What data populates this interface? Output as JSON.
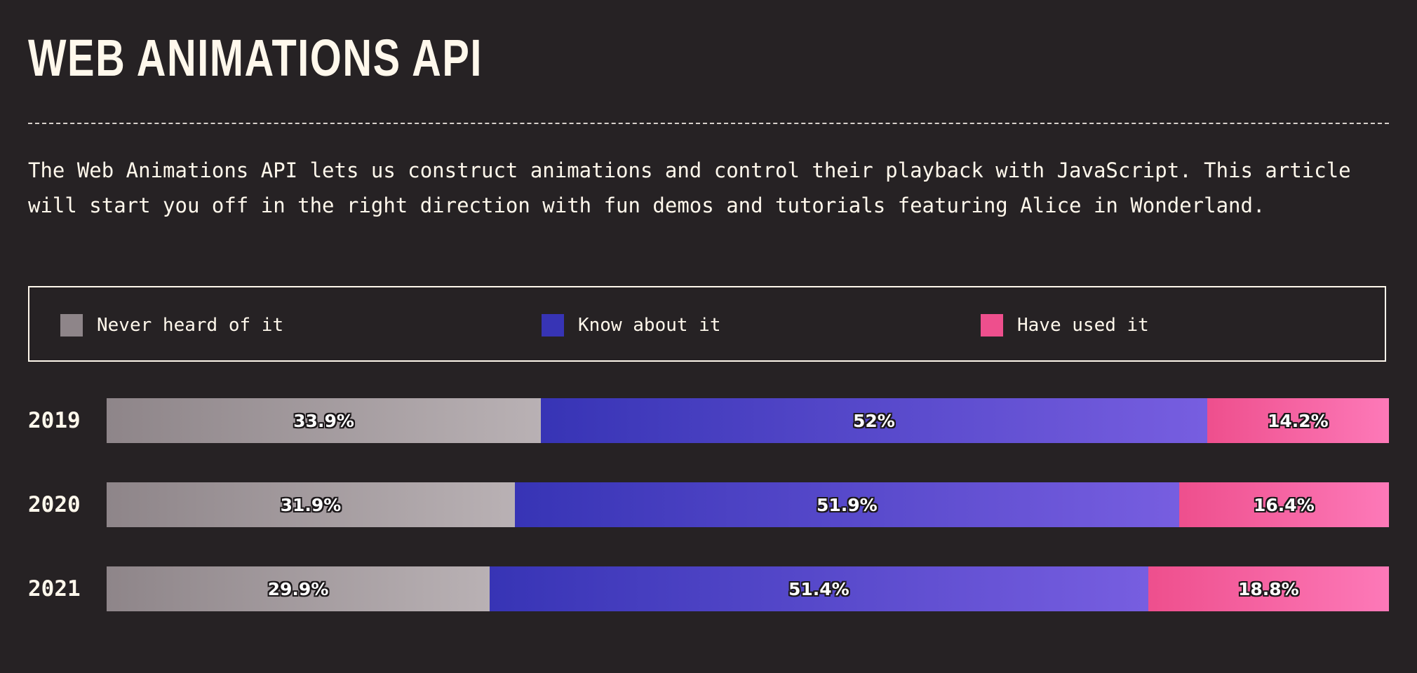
{
  "title": "WEB ANIMATIONS API",
  "description": "The Web Animations API lets us construct animations and control their playback with JavaScript. This article will start you off in the right direction with fun demos and tutorials featuring Alice in Wonderland.",
  "legend": [
    {
      "label": "Never heard of it",
      "color": "#8e8589"
    },
    {
      "label": "Know about it",
      "color": "#3734b5"
    },
    {
      "label": "Have used it",
      "color": "#ee4f8d"
    }
  ],
  "chart_data": {
    "type": "bar",
    "orientation": "horizontal",
    "stacked": true,
    "categories": [
      "2019",
      "2020",
      "2021"
    ],
    "series": [
      {
        "name": "Never heard of it",
        "values": [
          33.9,
          31.9,
          29.9
        ],
        "labels": [
          "33.9%",
          "31.9%",
          "29.9%"
        ]
      },
      {
        "name": "Know about it",
        "values": [
          52,
          51.9,
          51.4
        ],
        "labels": [
          "52%",
          "51.9%",
          "51.4%"
        ]
      },
      {
        "name": "Have used it",
        "values": [
          14.2,
          16.4,
          18.8
        ],
        "labels": [
          "14.2%",
          "16.4%",
          "18.8%"
        ]
      }
    ],
    "legend_placement": "top",
    "grid": false
  }
}
